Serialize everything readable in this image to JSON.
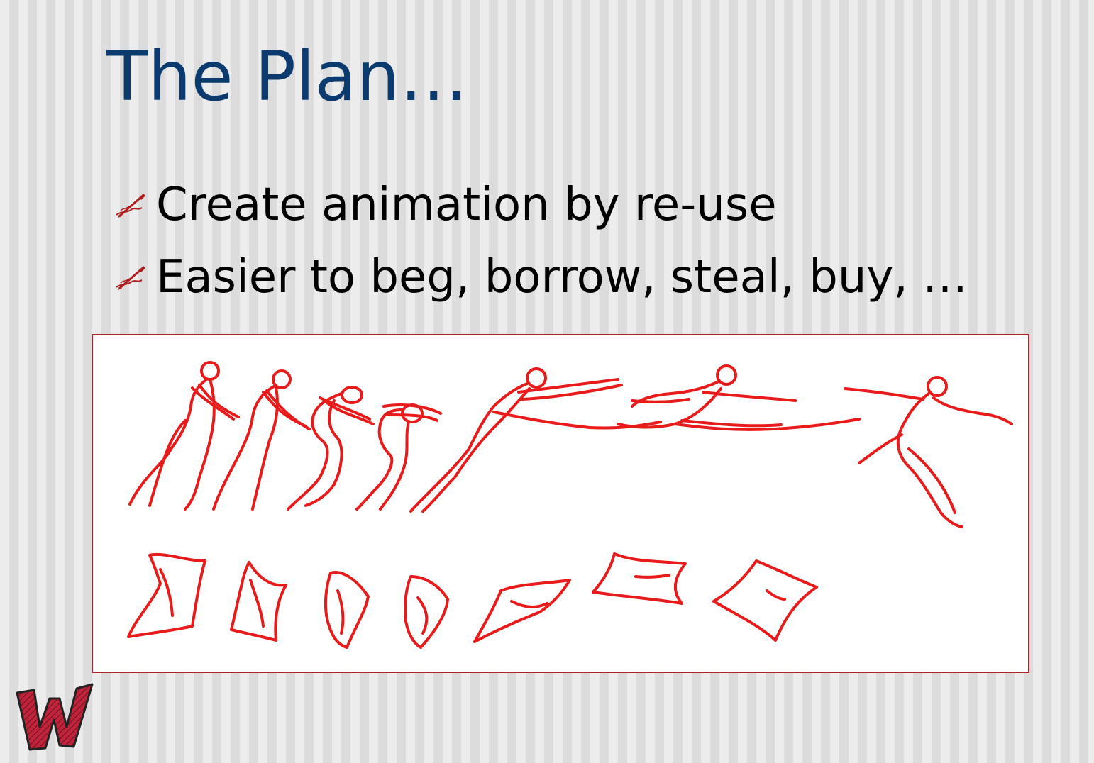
{
  "slide": {
    "title": "The Plan…",
    "bullets": [
      {
        "icon": "pen-writing-icon",
        "text": "Create animation by re-use"
      },
      {
        "icon": "pen-writing-icon",
        "text": "Easier to beg, borrow, steal, buy, …"
      }
    ]
  },
  "figure": {
    "stroke_color": "#e81a1a",
    "border_color": "#a8262b",
    "figures": [
      "stick-figure",
      "stick-figure",
      "stick-figure",
      "stick-figure",
      "stick-figure",
      "stick-figure",
      "stick-figure"
    ],
    "cloths": [
      "cloth",
      "cloth",
      "cloth",
      "cloth",
      "cloth",
      "cloth",
      "cloth"
    ]
  },
  "logo": {
    "icon": "w-logo-icon",
    "color": "#c0243a"
  },
  "colors": {
    "title": "#0b3a6f",
    "text": "#000000",
    "bullet": "#b01e1e"
  }
}
